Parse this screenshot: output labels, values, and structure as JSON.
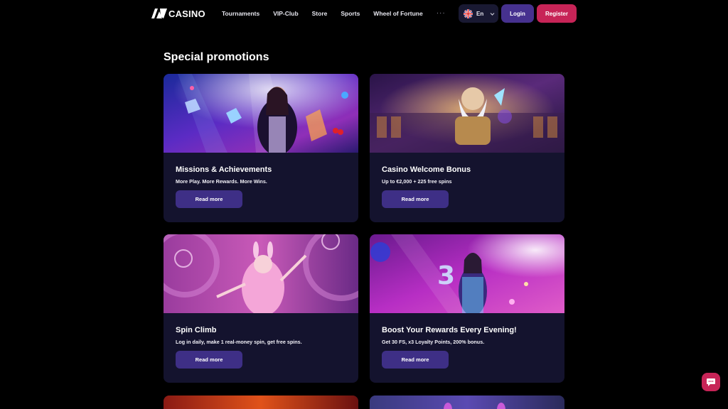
{
  "header": {
    "logo_text": "CASINO",
    "nav": [
      "Tournaments",
      "VIP-Club",
      "Store",
      "Sports",
      "Wheel of Fortune"
    ],
    "more": "···",
    "lang": "En",
    "login": "Login",
    "register": "Register"
  },
  "page": {
    "title": "Special promotions"
  },
  "promos": [
    {
      "title": "Missions & Achievements",
      "subtitle": "More Play. More Rewards. More Wins.",
      "button": "Read more"
    },
    {
      "title": "Casino Welcome Bonus",
      "subtitle": "Up to €2,000 + 225 free spins",
      "button": "Read more"
    },
    {
      "title": "Spin Climb",
      "subtitle": "Log in daily, make 1 real-money spin, get free spins.",
      "button": "Read more"
    },
    {
      "title": "Boost Your Rewards Every Evening!",
      "subtitle": "Get 30 FS, x3 Loyalty Points, 200% bonus.",
      "button": "Read more"
    }
  ],
  "colors": {
    "background": "#000000",
    "card": "#14132e",
    "login": "#46318f",
    "register": "#c72457",
    "card_button": "#3e2f86"
  },
  "icons": {
    "chat": "chat-icon",
    "flag": "uk-flag-icon",
    "chevron": "chevron-down-icon"
  }
}
